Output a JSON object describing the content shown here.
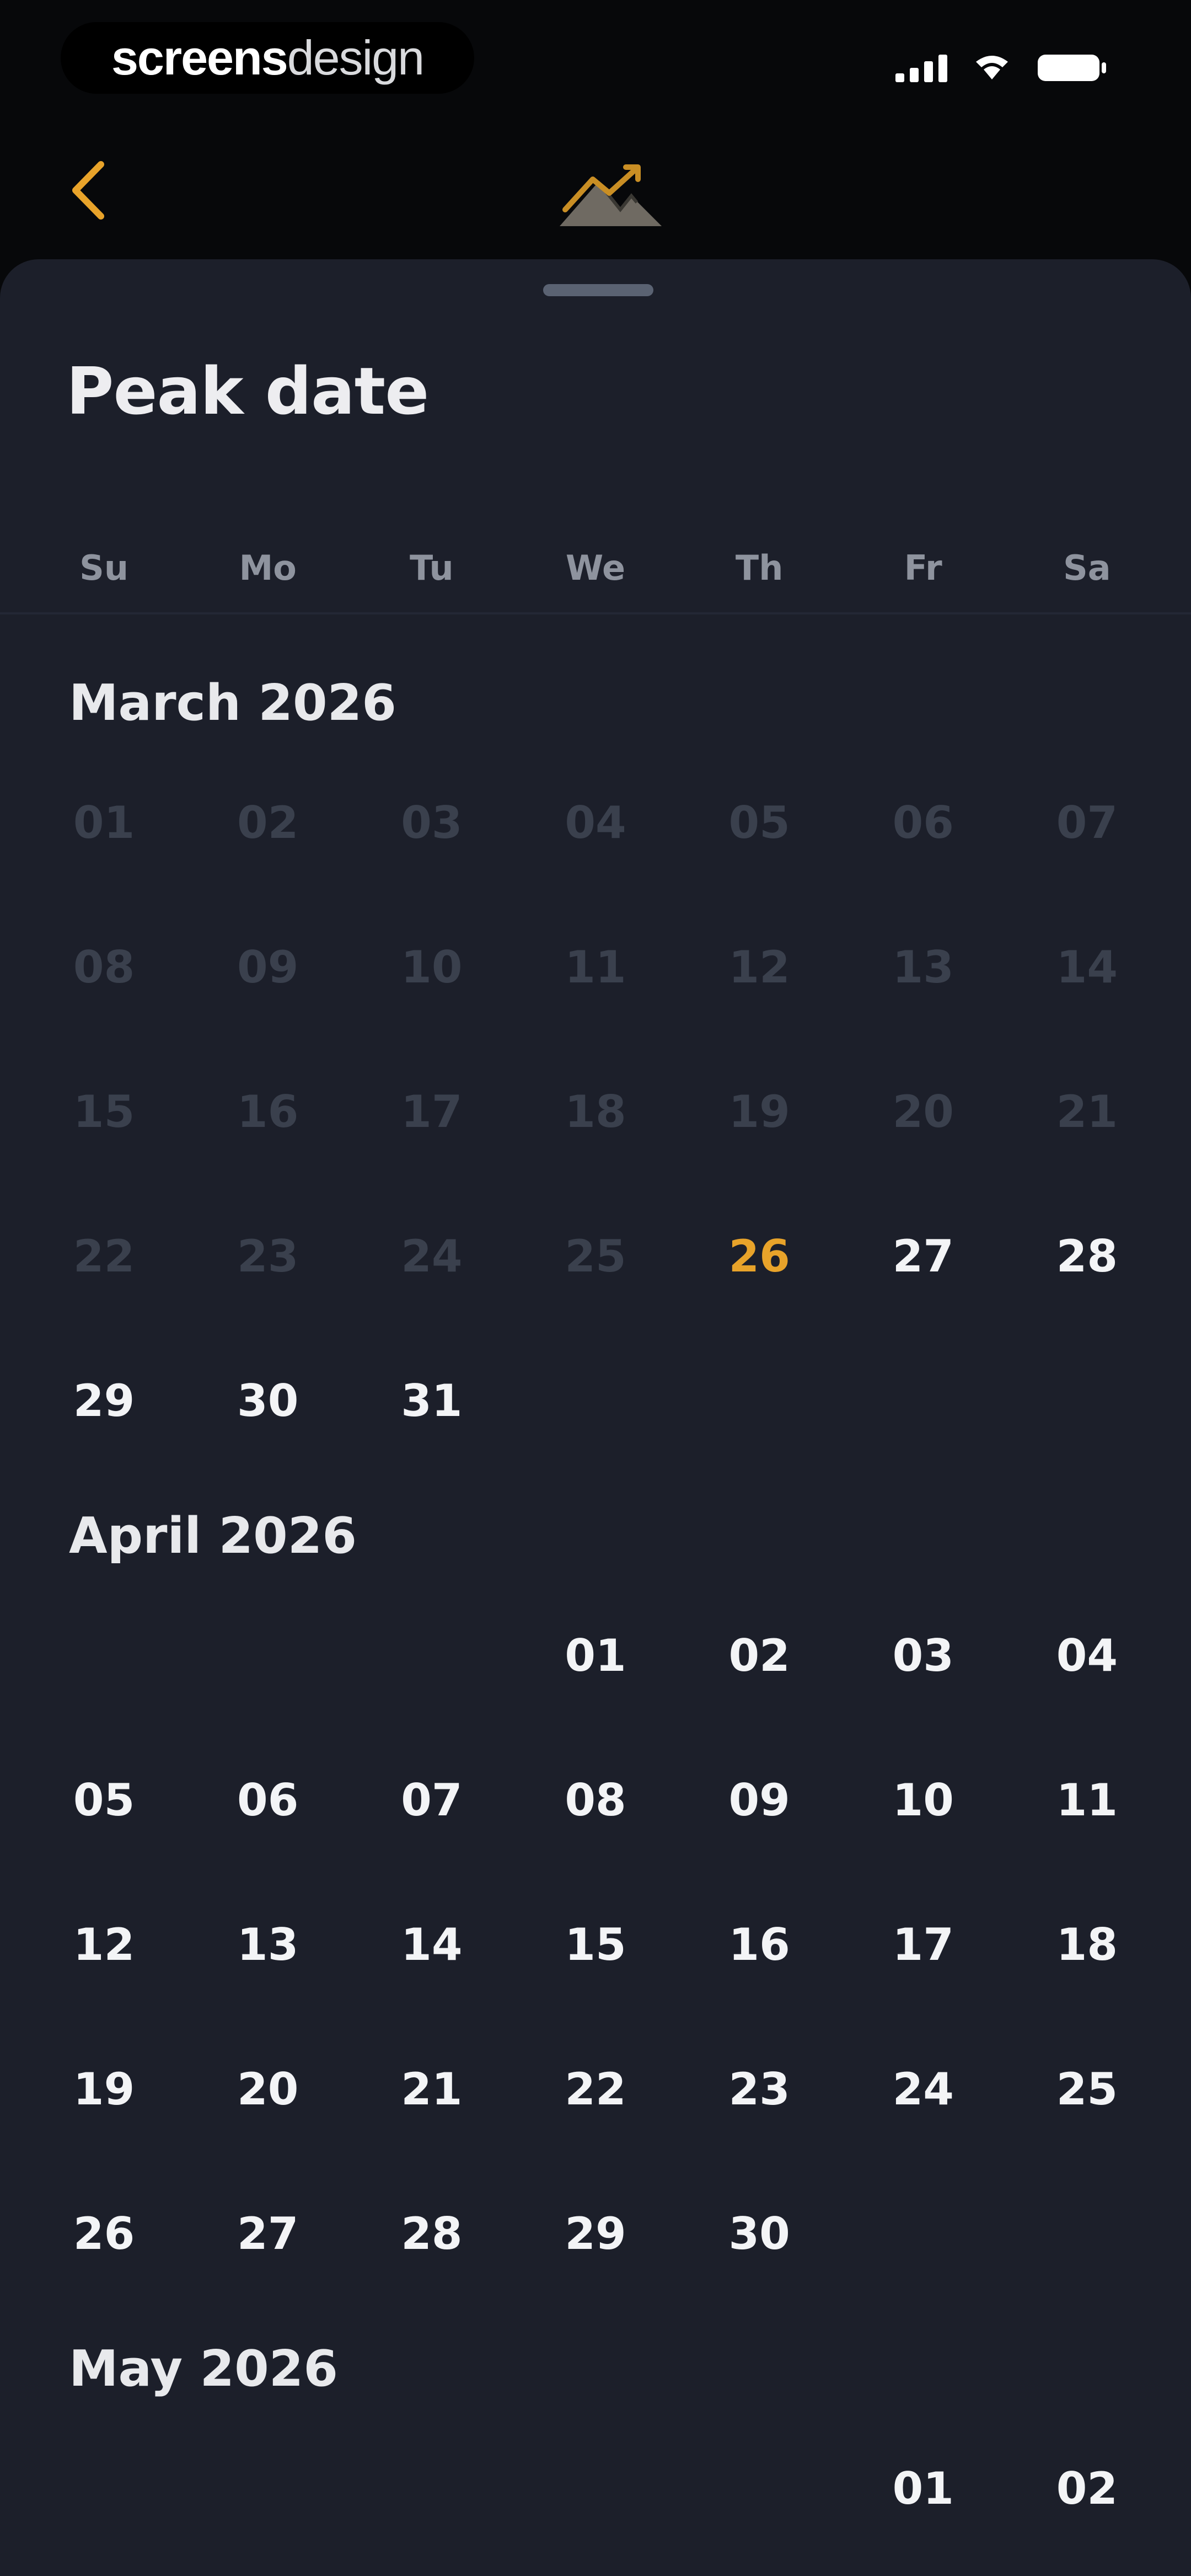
{
  "status_bar": {
    "brand_part1": "screens",
    "brand_part2": "design"
  },
  "icons": {
    "back": "chevron-left-icon",
    "logo": "mountain-peak-icon",
    "signal": "signal-icon",
    "wifi": "wifi-icon",
    "battery": "battery-icon"
  },
  "colors": {
    "accent": "#e8a32a",
    "sheet_bg": "#1c1f2a",
    "disabled_day": "#3a404d"
  },
  "sheet": {
    "title": "Peak date"
  },
  "weekdays": [
    "Su",
    "Mo",
    "Tu",
    "We",
    "Th",
    "Fr",
    "Sa"
  ],
  "today": "26",
  "months": [
    {
      "title": "March 2026",
      "days": [
        [
          "01",
          "02",
          "03",
          "04",
          "05",
          "06",
          "07"
        ],
        [
          "08",
          "09",
          "10",
          "11",
          "12",
          "13",
          "14"
        ],
        [
          "15",
          "16",
          "17",
          "18",
          "19",
          "20",
          "21"
        ],
        [
          "22",
          "23",
          "24",
          "25",
          "26",
          "27",
          "28"
        ],
        [
          "29",
          "30",
          "31",
          "",
          "",
          "",
          ""
        ]
      ]
    },
    {
      "title": "April 2026",
      "days": [
        [
          "",
          "",
          "",
          "01",
          "02",
          "03",
          "04"
        ],
        [
          "05",
          "06",
          "07",
          "08",
          "09",
          "10",
          "11"
        ],
        [
          "12",
          "13",
          "14",
          "15",
          "16",
          "17",
          "18"
        ],
        [
          "19",
          "20",
          "21",
          "22",
          "23",
          "24",
          "25"
        ],
        [
          "26",
          "27",
          "28",
          "29",
          "30",
          "",
          ""
        ]
      ]
    },
    {
      "title": "May 2026",
      "days": [
        [
          "",
          "",
          "",
          "",
          "",
          "01",
          "02"
        ]
      ]
    }
  ]
}
